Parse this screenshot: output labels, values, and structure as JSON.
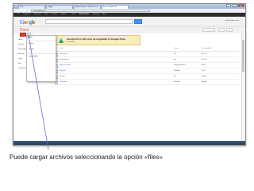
{
  "browser": {
    "tabs": [
      {
        "label": "Inicio - ..."
      },
      {
        "label": "Blogger"
      },
      {
        "label": "Página principal - Windows Live"
      },
      {
        "label": "Inicio - Google Docs"
      }
    ],
    "window_buttons": [
      "–",
      "▢",
      "✕"
    ],
    "address": "docs.google.com"
  },
  "google_bar": {
    "items": [
      "+Tú",
      "Búsqueda",
      "Imágenes",
      "Maps",
      "YouTube",
      "Noticias",
      "Gmail",
      "Documentos",
      "Calendar",
      "Más"
    ],
    "active_index": 7
  },
  "header": {
    "logo": "Google",
    "user": "usuario@gmail.com"
  },
  "docs": {
    "title": "Docs",
    "sidebar": [
      "Home",
      "Starred",
      "Owned by me",
      "All items",
      "Trash",
      "Más",
      "Collections"
    ],
    "dropdown": [
      "Files...",
      "Folder...",
      "Settings",
      "Upload folder"
    ],
    "banner_title": "Google Docs will soon be upgraded to Google Drive",
    "banner_sub": "Get started",
    "columns": [
      "Title",
      "Owner",
      "Last modified"
    ],
    "rows": [
      {
        "name": "Documento",
        "owner": "me",
        "modified": "Jan 10"
      },
      {
        "name": "Presentación",
        "owner": "me",
        "modified": "Dec 20"
      },
      {
        "name": "Hoja de cálculo",
        "owner": "Comunicaciones",
        "modified": "Nov 3"
      },
      {
        "name": "Proyecto",
        "owner": "Facultad",
        "modified": "Oct 2"
      },
      {
        "name": "Informe",
        "owner": "me",
        "modified": "Sep 14"
      },
      {
        "name": "Formulario",
        "owner": "Facultad",
        "modified": "Aug 30"
      }
    ]
  },
  "caption": "Puede cargar archivos seleccionando la opción «files»"
}
